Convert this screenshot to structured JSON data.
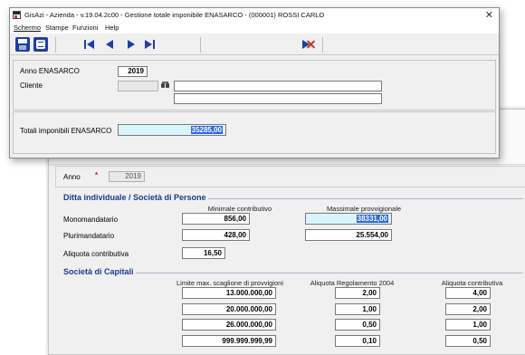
{
  "window": {
    "title": "GisAzi - Azienda - v.19.04.2c00 - Gestione totale imponibile ENASARCO - (000001) ROSSI CARLO",
    "close_glyph": "✕"
  },
  "menu": [
    "Schermo",
    "Stampe",
    "Funzioni",
    "Help"
  ],
  "toolbar": {
    "icons": [
      "save-icon",
      "exit-icon",
      "first-record-icon",
      "previous-record-icon",
      "next-record-icon",
      "last-record-icon",
      "delete-icon"
    ],
    "accent": "#1f3f9f",
    "delete_color": "#c0392b"
  },
  "form": {
    "anno_label": "Anno ENASARCO",
    "anno_value": "2019",
    "cliente_label": "Cliente",
    "cliente_code": "",
    "cliente_name_1": "",
    "cliente_name_2": "",
    "totali_label": "Totali imponibili ENASARCO",
    "totali_value": "35285,00"
  },
  "background": {
    "anno_label": "Anno",
    "anno_required": "*",
    "anno_value": "2019",
    "ditta": {
      "title": "Ditta individuale / Società di Persone",
      "col_minimale": "Minimale contributivo",
      "col_massimale": "Massimale provvigionale",
      "mono_label": "Monomandatario",
      "mono_min": "856,00",
      "mono_max": "38331,00",
      "pluri_label": "Plurimandatario",
      "pluri_min": "428,00",
      "pluri_max": "25.554,00",
      "aliquota_label": "Aliquota contributiva",
      "aliquota_value": "16,50"
    },
    "capitali": {
      "title": "Società di Capitali",
      "col_limite": "Limite max. scaglione di provvigioni",
      "col_regolamento": "Aliquota Regolamento 2004",
      "col_aliquota": "Aliquota contributiva",
      "rows": [
        {
          "limite": "13.000.000,00",
          "regolamento": "2,00",
          "aliquota": "4,00"
        },
        {
          "limite": "20.000.000,00",
          "regolamento": "1,00",
          "aliquota": "2,00"
        },
        {
          "limite": "26.000.000,00",
          "regolamento": "0,50",
          "aliquota": "1,00"
        },
        {
          "limite": "999.999.999,99",
          "regolamento": "0,10",
          "aliquota": "0,50"
        }
      ]
    }
  }
}
